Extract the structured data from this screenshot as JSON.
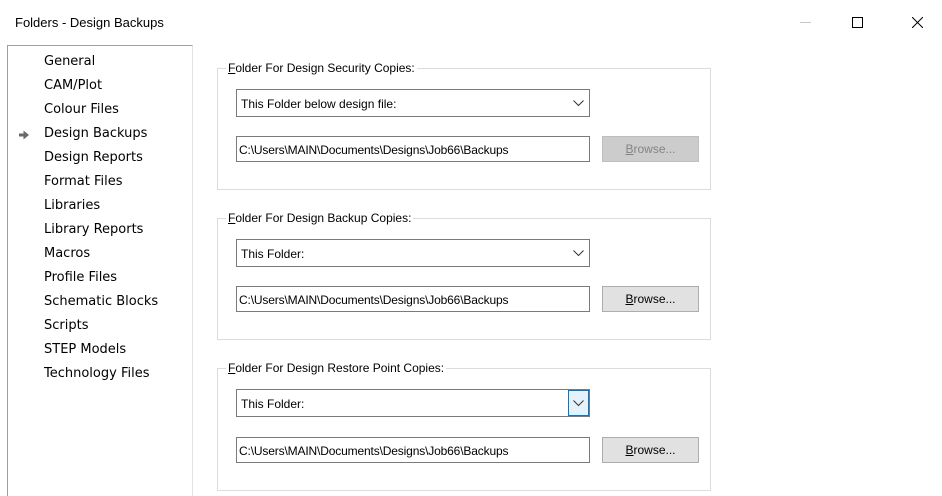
{
  "window": {
    "title": "Folders - Design Backups",
    "minimize": "minimize",
    "maximize": "maximize",
    "close": "close"
  },
  "sidebar": {
    "selected_index": 3,
    "items": [
      {
        "label": "General"
      },
      {
        "label": "CAM/Plot"
      },
      {
        "label": "Colour Files"
      },
      {
        "label": "Design Backups"
      },
      {
        "label": "Design Reports"
      },
      {
        "label": "Format Files"
      },
      {
        "label": "Libraries"
      },
      {
        "label": "Library Reports"
      },
      {
        "label": "Macros"
      },
      {
        "label": "Profile Files"
      },
      {
        "label": "Schematic Blocks"
      },
      {
        "label": "Scripts"
      },
      {
        "label": "STEP Models"
      },
      {
        "label": "Technology Files"
      }
    ]
  },
  "groups": {
    "security": {
      "title_mnemonic": "F",
      "title_rest": "older For Design Security Copies:",
      "combo_value": "This Folder below design file:",
      "path": "C:\\Users\\MAIN\\Documents\\Designs\\Job66\\Backups",
      "browse_mnemonic": "B",
      "browse_rest": "rowse...",
      "browse_enabled": false
    },
    "backup": {
      "title_mnemonic": "F",
      "title_rest": "older For Design Backup Copies:",
      "combo_value": "This Folder:",
      "path": "C:\\Users\\MAIN\\Documents\\Designs\\Job66\\Backups",
      "browse_mnemonic": "B",
      "browse_rest": "rowse...",
      "browse_enabled": true
    },
    "restore": {
      "title_mnemonic": "F",
      "title_rest": "older For Design Restore Point Copies:",
      "combo_value": "This Folder:",
      "path": "C:\\Users\\MAIN\\Documents\\Designs\\Job66\\Backups",
      "browse_mnemonic": "B",
      "browse_rest": "rowse...",
      "browse_enabled": true
    }
  },
  "icons": {
    "selected_arrow": "arrow-right-icon",
    "dropdown": "chevron-down-icon"
  },
  "colors": {
    "focus_border": "#0078d7",
    "focus_fill": "#e5f1fb",
    "disabled_text": "#838383"
  }
}
